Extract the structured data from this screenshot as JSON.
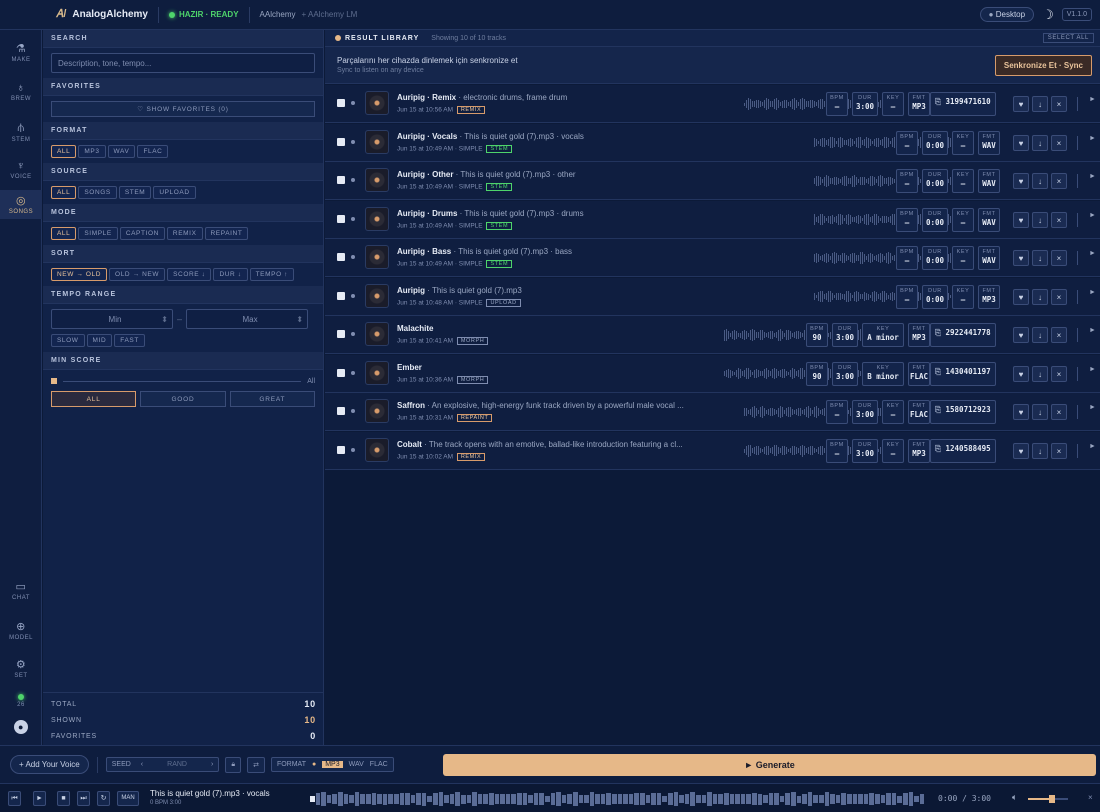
{
  "app": {
    "brand": "AnalogAlchemy",
    "status": "HAZIR · READY",
    "crumb1": "AAlchemy",
    "crumb2": "+ AAlchemy LM",
    "device": "Desktop",
    "version": "V1.1.0",
    "colors": {
      "accent": "#d79b6b",
      "ready": "#4ed46b",
      "bg": "#0c1a38"
    }
  },
  "rail": {
    "top": [
      {
        "label": "MAKE",
        "icon": "flask-icon"
      },
      {
        "label": "BREW",
        "icon": "potion-icon"
      },
      {
        "label": "STEM",
        "icon": "stem-icon"
      },
      {
        "label": "VOICE",
        "icon": "mic-icon"
      },
      {
        "label": "SONGS",
        "icon": "disc-icon",
        "active": true
      }
    ],
    "bottom": [
      {
        "label": "CHAT",
        "icon": "chat-icon"
      },
      {
        "label": "MODEL",
        "icon": "model-icon"
      },
      {
        "label": "SET",
        "icon": "settings-icon"
      }
    ],
    "version_dot": "26"
  },
  "filters": {
    "search_title": "SEARCH",
    "search_placeholder": "Description, tone, tempo...",
    "favorites_title": "FAVORITES",
    "show_favorites": "♡ SHOW FAVORITES (0)",
    "format_title": "FORMAT",
    "format": [
      "ALL",
      "MP3",
      "WAV",
      "FLAC"
    ],
    "source_title": "SOURCE",
    "source": [
      "ALL",
      "SONGS",
      "STEM",
      "UPLOAD"
    ],
    "mode_title": "MODE",
    "mode": [
      "ALL",
      "SIMPLE",
      "CAPTION",
      "REMIX",
      "REPAINT"
    ],
    "sort_title": "SORT",
    "sort": [
      "NEW → OLD",
      "OLD → NEW",
      "SCORE ↓",
      "DUR ↓",
      "TEMPO ↑"
    ],
    "tempo_title": "TEMPO RANGE",
    "tempo_min": "Min",
    "tempo_max": "Max",
    "tempo_presets": [
      "SLOW",
      "MID",
      "FAST"
    ],
    "score_title": "MIN SCORE",
    "score_value": "All",
    "score_buttons": [
      "ALL",
      "GOOD",
      "GREAT"
    ],
    "totals": [
      {
        "label": "TOTAL",
        "value": "10"
      },
      {
        "label": "SHOWN",
        "value": "10"
      },
      {
        "label": "FAVORITES",
        "value": "0"
      }
    ]
  },
  "results": {
    "title": "RESULT LIBRARY",
    "showing": "Showing 10 of 10 tracks",
    "select_all": "SELECT ALL",
    "sync_line1": "Parçalarını her cihazda dinlemek için senkronize et",
    "sync_line2": "Sync to listen on any device",
    "sync_button": "Senkronize Et · Sync",
    "stat_labels": {
      "bpm": "BPM",
      "dur": "DUR",
      "key": "KEY",
      "fmt": "FMT"
    },
    "tracks": [
      {
        "name": "Auripig · Remix",
        "desc": " · electronic drums, frame drum",
        "date": "Jun 15 at 10:56 AM",
        "mode": "",
        "tag": "REMIX",
        "bpm": "–",
        "dur": "3:00",
        "key": "–",
        "fmt": "MP3",
        "seed": "3199471610"
      },
      {
        "name": "Auripig · Vocals",
        "desc": " · This is quiet gold (7).mp3 · vocals",
        "date": "Jun 15 at 10:49 AM",
        "mode": " · SIMPLE",
        "tag": "STEM",
        "bpm": "–",
        "dur": "0:00",
        "key": "–",
        "fmt": "WAV",
        "seed": ""
      },
      {
        "name": "Auripig · Other",
        "desc": " · This is quiet gold (7).mp3 · other",
        "date": "Jun 15 at 10:49 AM",
        "mode": " · SIMPLE",
        "tag": "STEM",
        "bpm": "–",
        "dur": "0:00",
        "key": "–",
        "fmt": "WAV",
        "seed": ""
      },
      {
        "name": "Auripig · Drums",
        "desc": " · This is quiet gold (7).mp3 · drums",
        "date": "Jun 15 at 10:49 AM",
        "mode": " · SIMPLE",
        "tag": "STEM",
        "bpm": "–",
        "dur": "0:00",
        "key": "–",
        "fmt": "WAV",
        "seed": ""
      },
      {
        "name": "Auripig · Bass",
        "desc": " · This is quiet gold (7).mp3 · bass",
        "date": "Jun 15 at 10:49 AM",
        "mode": " · SIMPLE",
        "tag": "STEM",
        "bpm": "–",
        "dur": "0:00",
        "key": "–",
        "fmt": "WAV",
        "seed": ""
      },
      {
        "name": "Auripig",
        "desc": " · This is quiet gold (7).mp3",
        "date": "Jun 15 at 10:48 AM",
        "mode": " · SIMPLE",
        "tag": "UPLOAD",
        "bpm": "–",
        "dur": "0:00",
        "key": "–",
        "fmt": "MP3",
        "seed": ""
      },
      {
        "name": "Malachite",
        "desc": "",
        "date": "Jun 15 at 10:41 AM",
        "mode": "",
        "tag": "MORPH",
        "bpm": "90",
        "dur": "3:00",
        "key": "A minor",
        "fmt": "MP3",
        "seed": "2922441778"
      },
      {
        "name": "Ember",
        "desc": "",
        "date": "Jun 15 at 10:36 AM",
        "mode": "",
        "tag": "MORPH",
        "bpm": "90",
        "dur": "3:00",
        "key": "B minor",
        "fmt": "FLAC",
        "seed": "1430401197"
      },
      {
        "name": "Saffron",
        "desc": " · An explosive, high-energy funk track driven by a powerful male vocal ...",
        "date": "Jun 15 at 10:31 AM",
        "mode": "",
        "tag": "REPAINT",
        "bpm": "–",
        "dur": "3:00",
        "key": "–",
        "fmt": "FLAC",
        "seed": "1580712923"
      },
      {
        "name": "Cobalt",
        "desc": " · The track opens with an emotive, ballad-like introduction featuring a cl...",
        "date": "Jun 15 at 10:02 AM",
        "mode": "",
        "tag": "REMIX",
        "bpm": "–",
        "dur": "3:00",
        "key": "–",
        "fmt": "MP3",
        "seed": "1240588495"
      }
    ]
  },
  "generator": {
    "add_voice": "+ Add Your Voice",
    "seed_label": "SEED",
    "seed_value": "RAND",
    "format_label": "FORMAT",
    "formats": [
      "MP3",
      "WAV",
      "FLAC"
    ],
    "generate": "► Generate"
  },
  "player": {
    "mode": "MAN",
    "track": "This is quiet gold (7).mp3 · vocals",
    "sub": "0 BPM 3:00",
    "time": "0:00 / 3:00",
    "volume": 0.6
  }
}
